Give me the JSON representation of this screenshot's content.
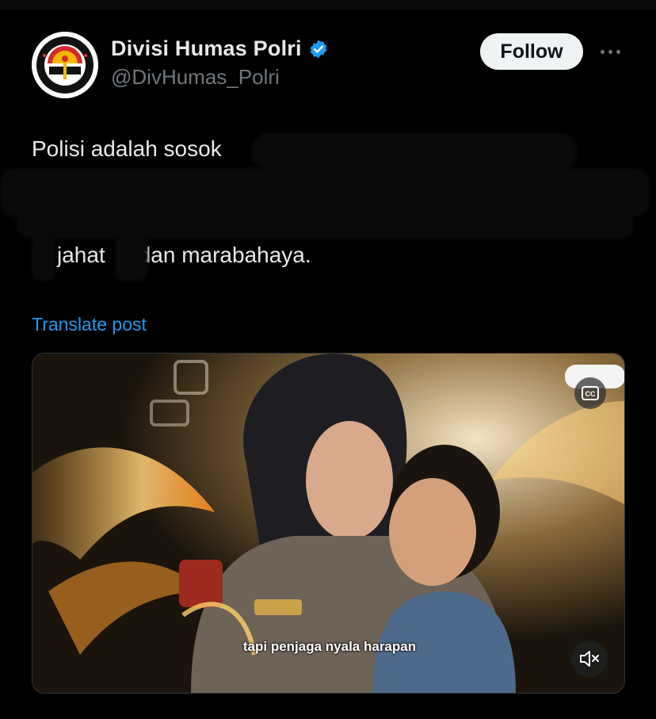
{
  "account": {
    "display_name": "Divisi Humas Polri",
    "handle": "@DivHumas_Polri",
    "verified": true,
    "avatar_icon": "humas-polri-emblem"
  },
  "actions": {
    "follow_label": "Follow",
    "more_icon": "more-horizontal-icon"
  },
  "tweet": {
    "line1_visible": "Polisi adalah sosok",
    "line2_word1": "jahat",
    "line2_rest": "dan marabahaya.",
    "redacted": true
  },
  "translate_label": "Translate post",
  "media": {
    "type": "video",
    "caption": "tapi penjaga nyala harapan",
    "mute_icon": "volume-muted-icon",
    "cc_icon": "closed-captions-icon"
  },
  "colors": {
    "background": "#000000",
    "text": "#e7e9ea",
    "secondary": "#71767b",
    "link": "#1d9bf0",
    "verified": "#1d9bf0",
    "follow_bg": "#eff3f4"
  }
}
